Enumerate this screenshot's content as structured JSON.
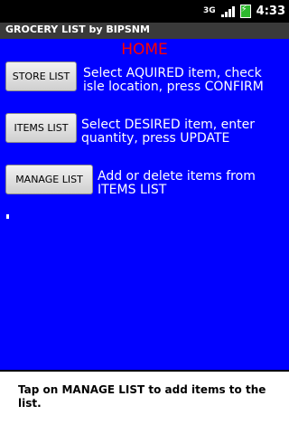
{
  "status_bar": {
    "time": "4:33",
    "network": "3G",
    "icons": [
      "network-3g-icon",
      "signal-bars-icon",
      "battery-charging-icon"
    ]
  },
  "app": {
    "title": "GROCERY LIST by BIPSNM"
  },
  "home": {
    "heading": "HOME",
    "colors": {
      "background": "#0000ff",
      "heading": "#ff0000",
      "text": "#ffffff"
    }
  },
  "menu": [
    {
      "button": "STORE LIST",
      "description": "Select AQUIRED item, check isle location, press CONFIRM"
    },
    {
      "button": "ITEMS LIST",
      "description": "Select DESIRED item, enter quantity, press UPDATE"
    },
    {
      "button": "MANAGE LIST",
      "description": "Add or delete items from ITEMS LIST"
    }
  ],
  "hint": "Tap on MANAGE LIST to add items to the list."
}
